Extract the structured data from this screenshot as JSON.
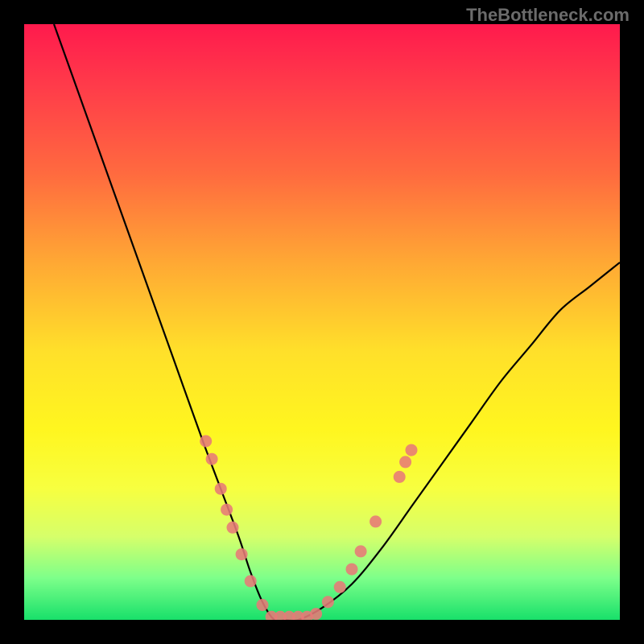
{
  "attribution": "TheBottleneck.com",
  "colors": {
    "frame": "#000000",
    "gradient_top": "#ff1a4d",
    "gradient_bottom": "#18e06a",
    "curve": "#000000",
    "dots": "#e77a77"
  },
  "chart_data": {
    "type": "line",
    "title": "",
    "xlabel": "",
    "ylabel": "",
    "xlim": [
      0,
      100
    ],
    "ylim": [
      0,
      100
    ],
    "series": [
      {
        "name": "bottleneck-curve",
        "x": [
          5,
          10,
          15,
          20,
          25,
          30,
          33,
          36,
          38,
          40,
          42,
          44,
          46,
          50,
          55,
          60,
          65,
          70,
          75,
          80,
          85,
          90,
          95,
          100
        ],
        "values": [
          100,
          86,
          72,
          58,
          44,
          30,
          22,
          14,
          8,
          3,
          0,
          0,
          0,
          2,
          6,
          12,
          19,
          26,
          33,
          40,
          46,
          52,
          56,
          60
        ]
      }
    ],
    "markers": [
      {
        "x": 30.5,
        "y": 30
      },
      {
        "x": 31.5,
        "y": 27
      },
      {
        "x": 33.0,
        "y": 22
      },
      {
        "x": 34.0,
        "y": 18.5
      },
      {
        "x": 35.0,
        "y": 15.5
      },
      {
        "x": 36.5,
        "y": 11
      },
      {
        "x": 38.0,
        "y": 6.5
      },
      {
        "x": 40.0,
        "y": 2.5
      },
      {
        "x": 41.5,
        "y": 0.5
      },
      {
        "x": 43.0,
        "y": 0.5
      },
      {
        "x": 44.5,
        "y": 0.5
      },
      {
        "x": 46.0,
        "y": 0.5
      },
      {
        "x": 47.5,
        "y": 0.5
      },
      {
        "x": 49.0,
        "y": 1.0
      },
      {
        "x": 51.0,
        "y": 3.0
      },
      {
        "x": 53.0,
        "y": 5.5
      },
      {
        "x": 55.0,
        "y": 8.5
      },
      {
        "x": 56.5,
        "y": 11.5
      },
      {
        "x": 59.0,
        "y": 16.5
      },
      {
        "x": 63.0,
        "y": 24
      },
      {
        "x": 64.0,
        "y": 26.5
      },
      {
        "x": 65.0,
        "y": 28.5
      }
    ]
  }
}
